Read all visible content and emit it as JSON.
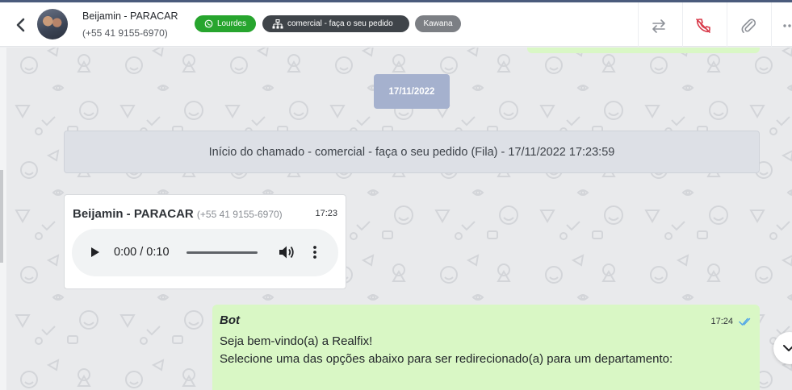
{
  "header": {
    "contact_name": "Beijamin - PARACAR",
    "contact_phone": "(+55 41 9155-6970)",
    "tags": {
      "agent": {
        "label": "Lourdes",
        "icon": "whatsapp-icon",
        "color": "#27a52e"
      },
      "queue": {
        "label": "comercial - faça o seu pedido",
        "icon": "sitemap-icon",
        "color": "#3f4449"
      },
      "tag": {
        "label": "Kawana",
        "color": "#7c7f84"
      }
    },
    "actions": [
      "transfer-icon",
      "end-call-icon",
      "attach-icon",
      "more-icon"
    ]
  },
  "chat": {
    "date_separator": "17/11/2022",
    "system_message": "Início do chamado - comercial - faça o seu pedido (Fila) - 17/11/2022 17:23:59",
    "audio_message": {
      "sender": "Beijamin - PARACAR",
      "sender_phone": "(+55 41 9155-6970)",
      "time": "17:23",
      "player_time": "0:00 / 0:10"
    },
    "bot_message": {
      "sender": "Bot",
      "time": "17:24",
      "lines": [
        "Seja bem-vindo(a) a Realfix!",
        "Selecione uma das opções abaixo para ser redirecionado(a) para um departamento:"
      ],
      "status": "read"
    }
  },
  "colors": {
    "outgoing_bubble": "#d9f7c5",
    "date_pill": "#a5b1ce",
    "read_ticks": "#53a6e7"
  }
}
